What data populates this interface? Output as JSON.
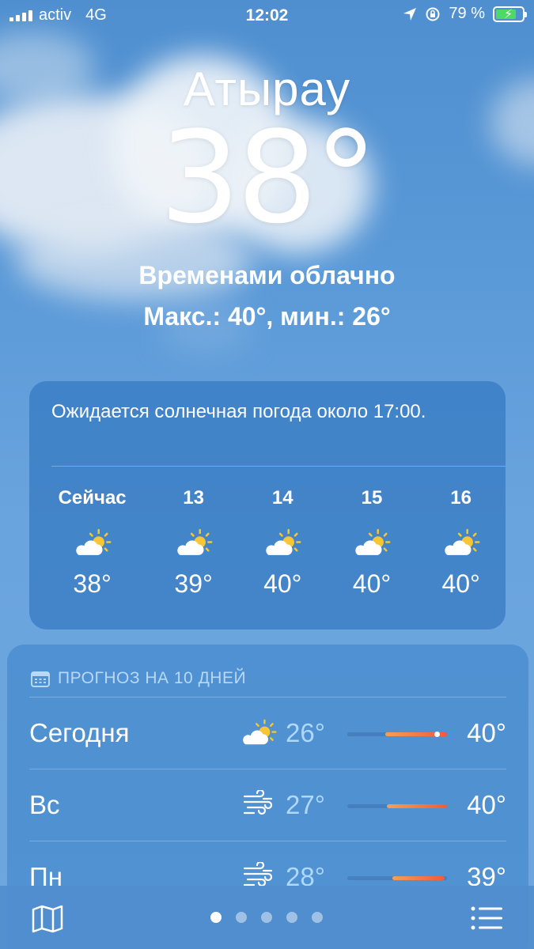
{
  "status_bar": {
    "carrier": "activ",
    "network": "4G",
    "time": "12:02",
    "battery_percent": "79 %",
    "battery_level": 0.79
  },
  "header": {
    "city": "Атырау",
    "temperature": "38°",
    "condition": "Временами облачно",
    "high_low": "Макс.: 40°, мин.: 26°"
  },
  "hourly": {
    "message": "Ожидается солнечная погода около 17:00.",
    "items": [
      {
        "label": "Сейчас",
        "icon": "partly-sunny-icon",
        "temp": "38°"
      },
      {
        "label": "13",
        "icon": "partly-sunny-icon",
        "temp": "39°"
      },
      {
        "label": "14",
        "icon": "partly-sunny-icon",
        "temp": "40°"
      },
      {
        "label": "15",
        "icon": "partly-sunny-icon",
        "temp": "40°"
      },
      {
        "label": "16",
        "icon": "partly-sunny-icon",
        "temp": "40°"
      }
    ]
  },
  "forecast": {
    "title": "ПРОГНОЗ НА 10 ДНЕЙ",
    "days": [
      {
        "day": "Сегодня",
        "icon": "partly-sunny-icon",
        "low": "26°",
        "high": "40°",
        "range_start": 0.38,
        "range_end": 1.0,
        "current": 0.9
      },
      {
        "day": "Вс",
        "icon": "wind-icon",
        "low": "27°",
        "high": "40°",
        "range_start": 0.4,
        "range_end": 1.0
      },
      {
        "day": "Пн",
        "icon": "wind-icon",
        "low": "28°",
        "high": "39°",
        "range_start": 0.45,
        "range_end": 0.97
      }
    ]
  },
  "bottom_bar": {
    "pages": 5,
    "active_page": 0,
    "colors": {
      "range_start": "#f2a057",
      "range_end": "#f25a3a"
    }
  }
}
